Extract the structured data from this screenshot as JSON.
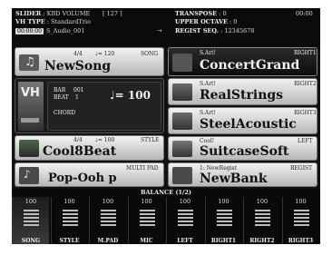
{
  "header": {
    "slider_label": "SLIDER",
    "slider_value": ": KBD VOLUME",
    "slider_num": "[ 127 ]",
    "vh_type_label": "VH TYPE",
    "vh_type_value": ": StandardTrio",
    "time": "00:00:00",
    "audio_file": "S_Audio_001",
    "transpose_label": "TRANSPOSE",
    "transpose_value": ": 0",
    "upper_octave_label": "UPPER OCTAVE",
    "upper_octave_value": ": 0",
    "regist_seq_label": "REGIST SEQ.",
    "regist_seq_value": ": 12345678",
    "clock": "00:00"
  },
  "song": {
    "time_sig": "4/4",
    "tempo": "♩= 120",
    "tag": "SONG",
    "name": "NewSong"
  },
  "info": {
    "vh_logo": "VH",
    "bar_label": "BAR",
    "bar_value": "001",
    "beat_label": "BEAT",
    "beat_value": "1",
    "tempo": "♩= 100",
    "chord_label": "CHORD"
  },
  "style": {
    "time_sig": "4/4",
    "tempo": "♩= 100",
    "tag": "STYLE",
    "name": "Cool8Beat"
  },
  "multipad": {
    "tag": "MULTI PAD",
    "name": "Pop-Ooh p"
  },
  "voices": {
    "right1": {
      "type": "S.Art!",
      "tag": "RIGHT1",
      "name": "ConcertGrand"
    },
    "right2": {
      "type": "S.Art!",
      "tag": "RIGHT2",
      "name": "RealStrings"
    },
    "right3": {
      "type": "S.Art!",
      "tag": "RIGHT3",
      "name": "SteelAcoustic"
    },
    "left": {
      "type": "Cool!",
      "tag": "LEFT",
      "name": "SuitcaseSoft"
    }
  },
  "regist": {
    "sub": "1: NewRegist",
    "tag": "REGIST",
    "name": "NewBank"
  },
  "balance": {
    "title": "BALANCE (1/2)",
    "channels": [
      {
        "label": "SONG",
        "value": "100"
      },
      {
        "label": "STYLE",
        "value": "100"
      },
      {
        "label": "M.PAD",
        "value": "100"
      },
      {
        "label": "MIC",
        "value": "100"
      },
      {
        "label": "LEFT",
        "value": "100"
      },
      {
        "label": "RIGHT1",
        "value": "100"
      },
      {
        "label": "RIGHT2",
        "value": "100"
      },
      {
        "label": "RIGHT3",
        "value": "100"
      }
    ]
  }
}
